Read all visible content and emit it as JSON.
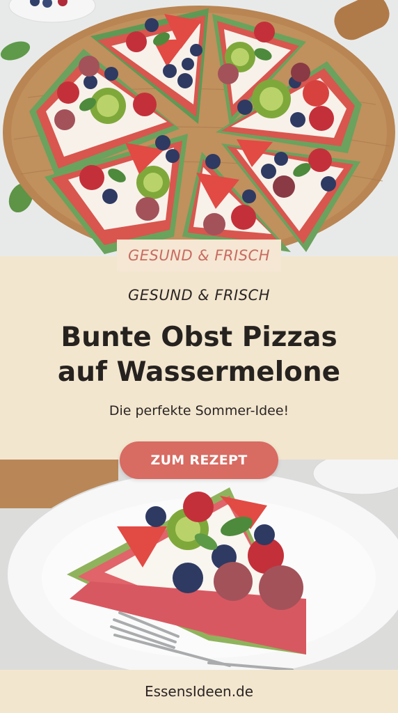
{
  "badge": {
    "text": "GESUND & FRISCH"
  },
  "header": {
    "subtitle": "GESUND & FRISCH",
    "title_line1": "Bunte Obst Pizzas",
    "title_line2": "auf Wassermelone",
    "tagline": "Die perfekte Sommer-Idee!"
  },
  "cta": {
    "label": "ZUM REZEPT"
  },
  "footer": {
    "site": "EssensIdeen.de"
  },
  "colors": {
    "background": "#f3e6cf",
    "accent": "#d86b62",
    "badge_text": "#c86b62",
    "text": "#26221f"
  },
  "images": {
    "top": "watermelon-pizza-board-photo",
    "bottom": "watermelon-slice-plate-photo"
  }
}
